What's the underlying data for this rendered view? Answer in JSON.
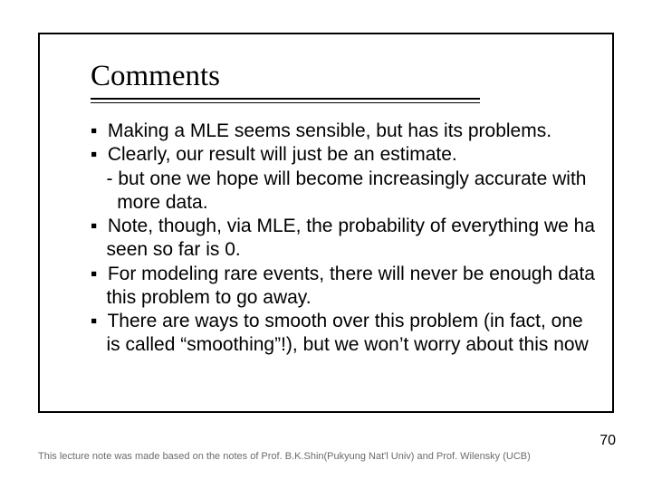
{
  "title": "Comments",
  "bullets": {
    "b1": "Making a MLE seems sensible, but has its problems.",
    "b2": "Clearly, our result will just be an estimate.",
    "b2s1": "- but one we hope will become increasingly accurate with",
    "b2s2": "more data.",
    "b3a": "Note, though, via MLE, the probability of everything we ha",
    "b3b": "seen so far is 0.",
    "b4a": "For modeling rare events, there will never be enough data",
    "b4b": "this problem to go away.",
    "b5a": "There are ways to smooth over this problem (in fact, one ",
    "b5b": "is called “smoothing”!), but we won’t worry about this now"
  },
  "footnote": "This lecture note was made based on the notes of Prof. B.K.Shin(Pukyung Nat'l Univ) and Prof. Wilensky (UCB)",
  "page": "70"
}
